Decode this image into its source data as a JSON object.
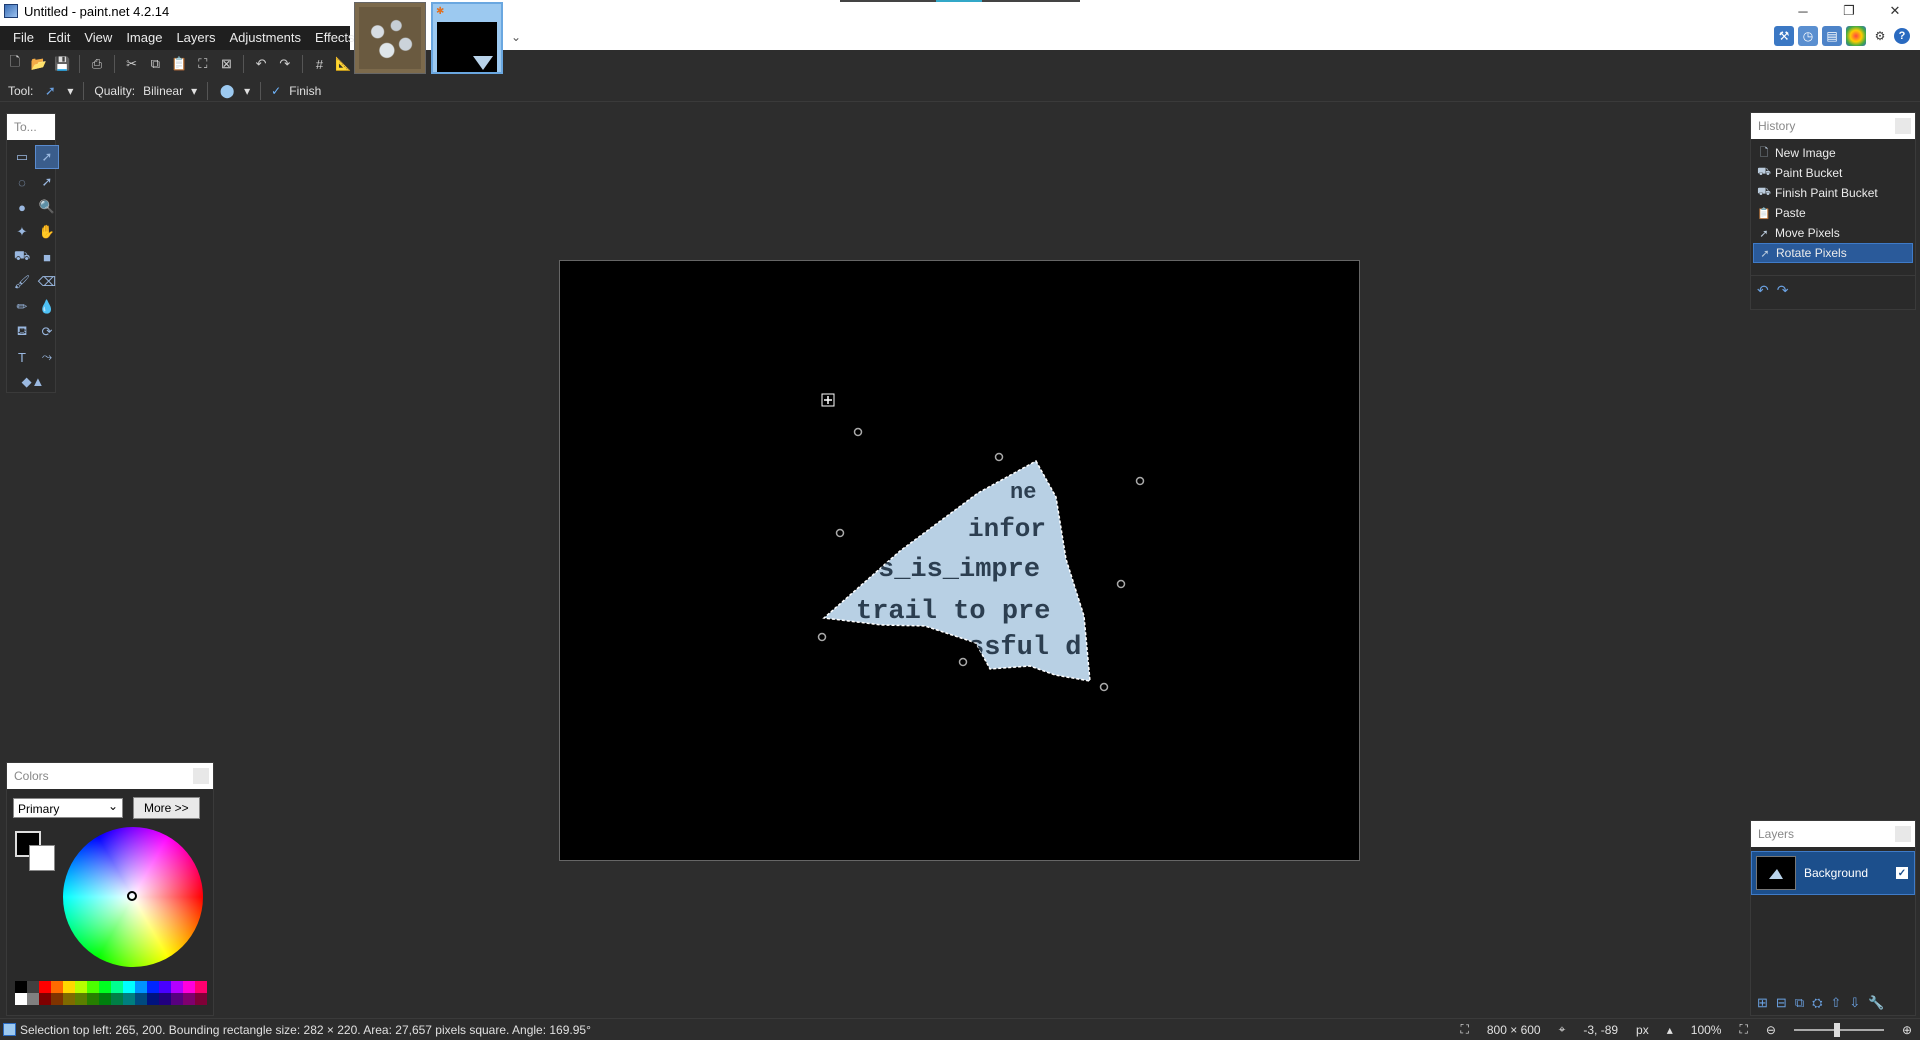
{
  "window": {
    "title": "Untitled - paint.net 4.2.14",
    "min": "─",
    "max": "❐",
    "close": "✕"
  },
  "menu": [
    "File",
    "Edit",
    "View",
    "Image",
    "Layers",
    "Adjustments",
    "Effects"
  ],
  "toolbar": {
    "tool_label": "Tool:",
    "quality_label": "Quality:",
    "quality_value": "Bilinear",
    "finish_label": "Finish"
  },
  "tools_panel": {
    "title": "To..."
  },
  "history": {
    "title": "History",
    "items": [
      "New Image",
      "Paint Bucket",
      "Finish Paint Bucket",
      "Paste",
      "Move Pixels",
      "Rotate Pixels"
    ],
    "selected_index": 5
  },
  "layers": {
    "title": "Layers",
    "items": [
      {
        "name": "Background",
        "visible": true
      }
    ]
  },
  "colors": {
    "title": "Colors",
    "mode": "Primary",
    "more_label": "More >>",
    "primary": "#000000",
    "secondary": "#ffffff",
    "palette": [
      "#000000",
      "#404040",
      "#ff0000",
      "#ff6a00",
      "#ffd800",
      "#b6ff00",
      "#4cff00",
      "#00ff21",
      "#00ff90",
      "#00ffff",
      "#0094ff",
      "#0026ff",
      "#4800ff",
      "#b200ff",
      "#ff00dc",
      "#ff006e",
      "#ffffff",
      "#808080",
      "#7f0000",
      "#7f3300",
      "#7f6a00",
      "#5b7f00",
      "#267f00",
      "#007f0e",
      "#007f46",
      "#007f7f",
      "#004a7f",
      "#00137f",
      "#21007f",
      "#57007f",
      "#7f006e",
      "#7f0037"
    ]
  },
  "canvas": {
    "image_text_lines": [
      "ne",
      "infor",
      "s_is_impre",
      "trail to pre",
      "ssful d"
    ]
  },
  "status": {
    "selection_text": "Selection top left: 265, 200. Bounding rectangle size: 282 × 220. Area: 27,657 pixels square. Angle: 169.95°",
    "image_size": "800 × 600",
    "cursor_pos": "-3, -89",
    "units": "px",
    "zoom": "100%"
  }
}
